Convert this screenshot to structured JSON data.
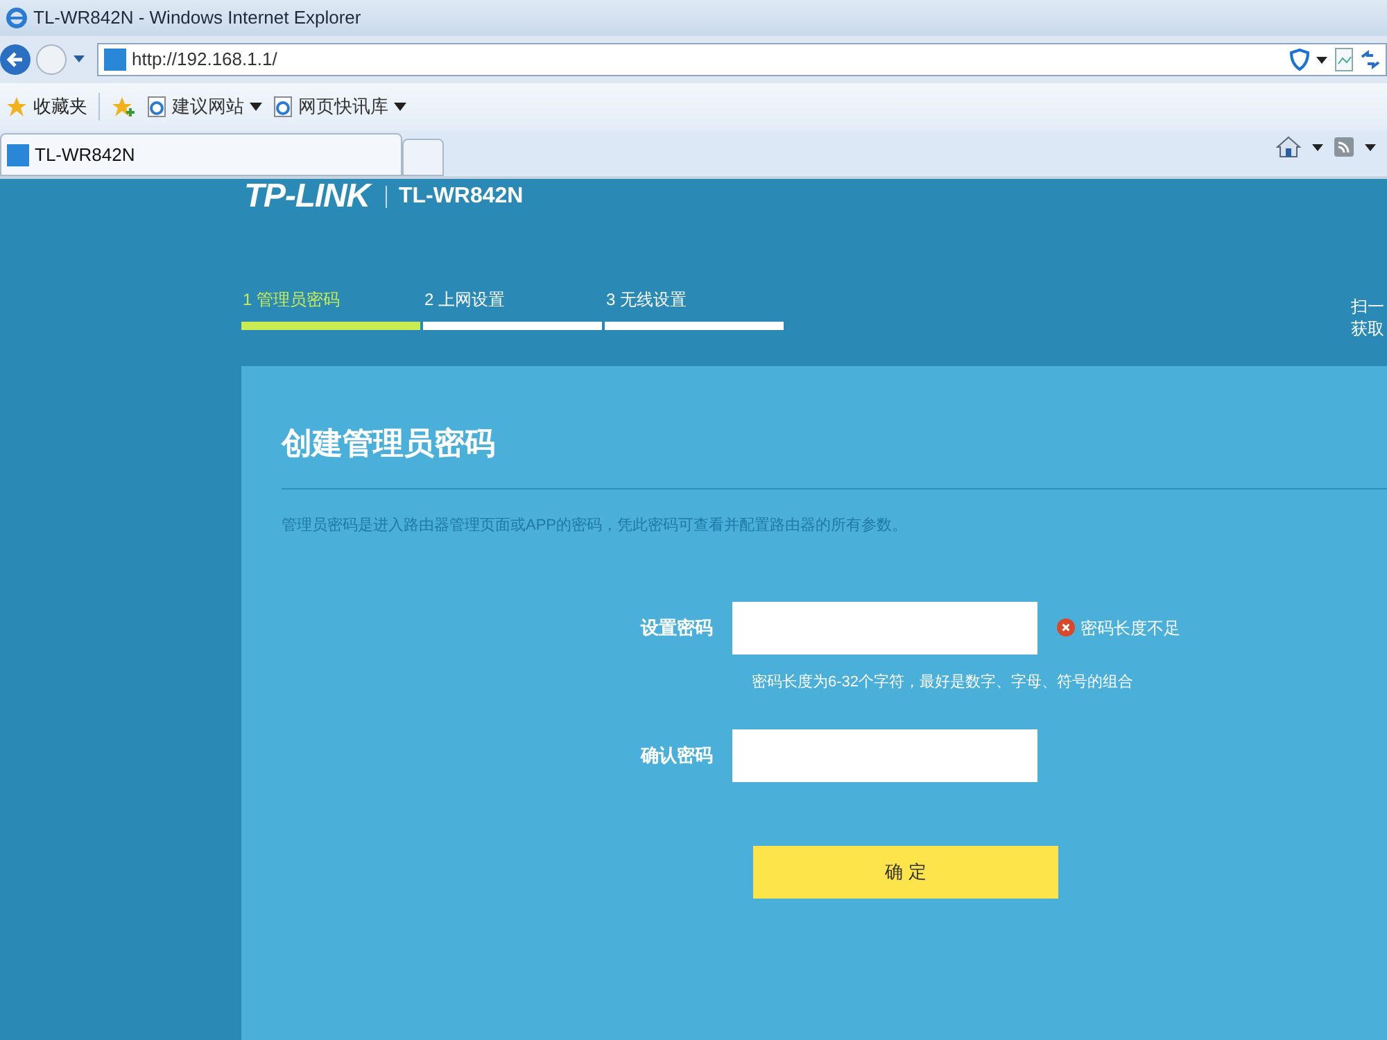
{
  "window": {
    "title": "TL-WR842N - Windows Internet Explorer"
  },
  "address_bar": {
    "url": "http://192.168.1.1/"
  },
  "favorites_bar": {
    "label": "收藏夹",
    "links": [
      {
        "label": "建议网站"
      },
      {
        "label": "网页快讯库"
      }
    ]
  },
  "tabs": [
    {
      "label": "TL-WR842N",
      "selected": true
    }
  ],
  "page": {
    "logo": "TP-LINK",
    "model": "TL-WR842N",
    "steps": [
      {
        "label": "1 管理员密码",
        "selected": true
      },
      {
        "label": "2 上网设置",
        "selected": false
      },
      {
        "label": "3 无线设置",
        "selected": false
      }
    ],
    "side_note": [
      "扫一",
      "获取"
    ],
    "title": "创建管理员密码",
    "description": "管理员密码是进入路由器管理页面或APP的密码，凭此密码可查看并配置路由器的所有参数。",
    "fields": [
      {
        "label": "设置密码",
        "error": "密码长度不足",
        "hint": "密码长度为6-32个字符，最好是数字、字母、符号的组合"
      },
      {
        "label": "确认密码"
      }
    ],
    "submit": "确 定"
  }
}
